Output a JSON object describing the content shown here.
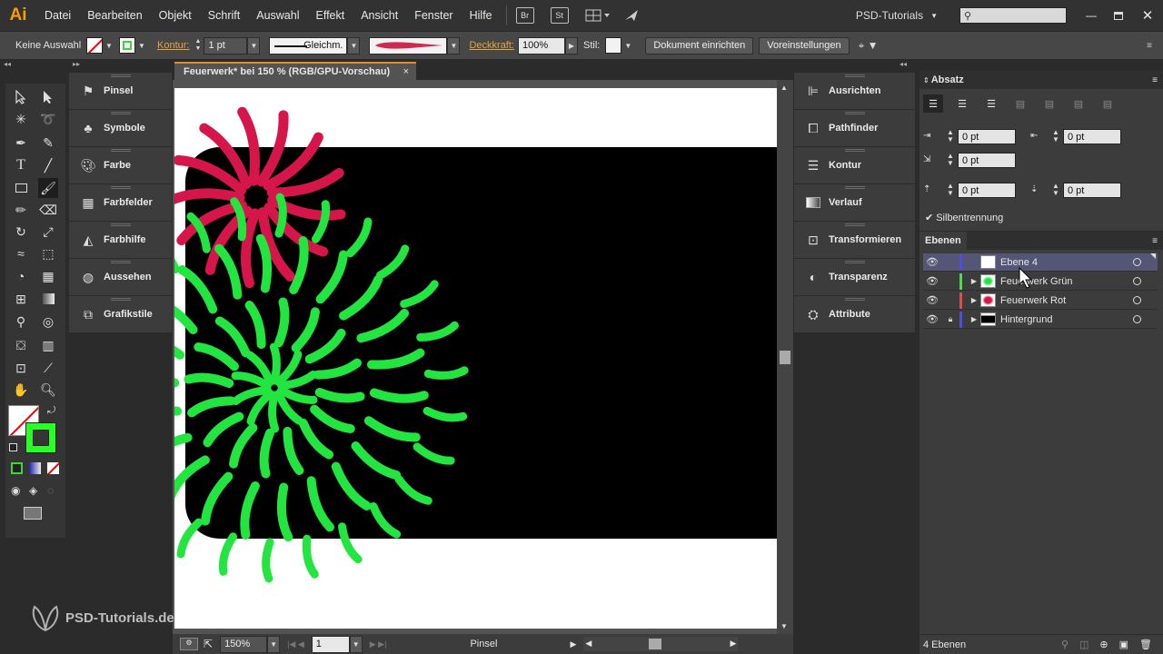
{
  "app": {
    "logo": "Ai",
    "workspace": "PSD-Tutorials"
  },
  "menu": [
    "Datei",
    "Bearbeiten",
    "Objekt",
    "Schrift",
    "Auswahl",
    "Effekt",
    "Ansicht",
    "Fenster",
    "Hilfe"
  ],
  "menu_icons": {
    "bridge": "Br",
    "stock": "St"
  },
  "control_bar": {
    "selection": "Keine Auswahl",
    "stroke_label": "Kontur:",
    "stroke_value": "1 pt",
    "stroke_style": "Gleichm.",
    "opacity_label": "Deckkraft:",
    "opacity_value": "100%",
    "style_label": "Stil:",
    "doc_setup": "Dokument einrichten",
    "preferences": "Voreinstellungen"
  },
  "document_tab": {
    "title": "Feuerwerk* bei 150 % (RGB/GPU-Vorschau)",
    "close": "×"
  },
  "left_dock": [
    {
      "label": "Pinsel",
      "icon": "brush-icon"
    },
    {
      "label": "Symbole",
      "icon": "symbols-icon"
    },
    {
      "label": "Farbe",
      "icon": "palette-icon"
    },
    {
      "label": "Farbfelder",
      "icon": "swatches-icon"
    },
    {
      "label": "Farbhilfe",
      "icon": "color-guide-icon"
    },
    {
      "label": "Aussehen",
      "icon": "appearance-icon"
    },
    {
      "label": "Grafikstile",
      "icon": "graphic-styles-icon"
    }
  ],
  "right_dock": [
    {
      "label": "Ausrichten",
      "icon": "align-icon"
    },
    {
      "label": "Pathfinder",
      "icon": "pathfinder-icon"
    },
    {
      "label": "Kontur",
      "icon": "stroke-icon"
    },
    {
      "label": "Verlauf",
      "icon": "gradient-icon"
    },
    {
      "label": "Transformieren",
      "icon": "transform-icon"
    },
    {
      "label": "Transparenz",
      "icon": "transparency-icon"
    },
    {
      "label": "Attribute",
      "icon": "attributes-icon"
    }
  ],
  "absatz": {
    "title": "Absatz",
    "indent_left": "0 pt",
    "indent_right": "0 pt",
    "first_line": "0 pt",
    "space_before": "0 pt",
    "space_after": "0 pt",
    "hyphenation": "Silbentrennung"
  },
  "layers": {
    "title": "Ebenen",
    "items": [
      {
        "name": "Ebene 4",
        "color": "#4f4fd9",
        "selected": true
      },
      {
        "name": "Feuerwerk Grün",
        "color": "#4fd94f",
        "selected": false
      },
      {
        "name": "Feuerwerk Rot",
        "color": "#d94f4f",
        "selected": false
      },
      {
        "name": "Hintergrund",
        "color": "#4f4fd9",
        "selected": false
      }
    ],
    "count": "4 Ebenen"
  },
  "status_bar": {
    "zoom": "150%",
    "artboard": "1",
    "tool": "Pinsel"
  },
  "watermark": "PSD-Tutorials.de"
}
